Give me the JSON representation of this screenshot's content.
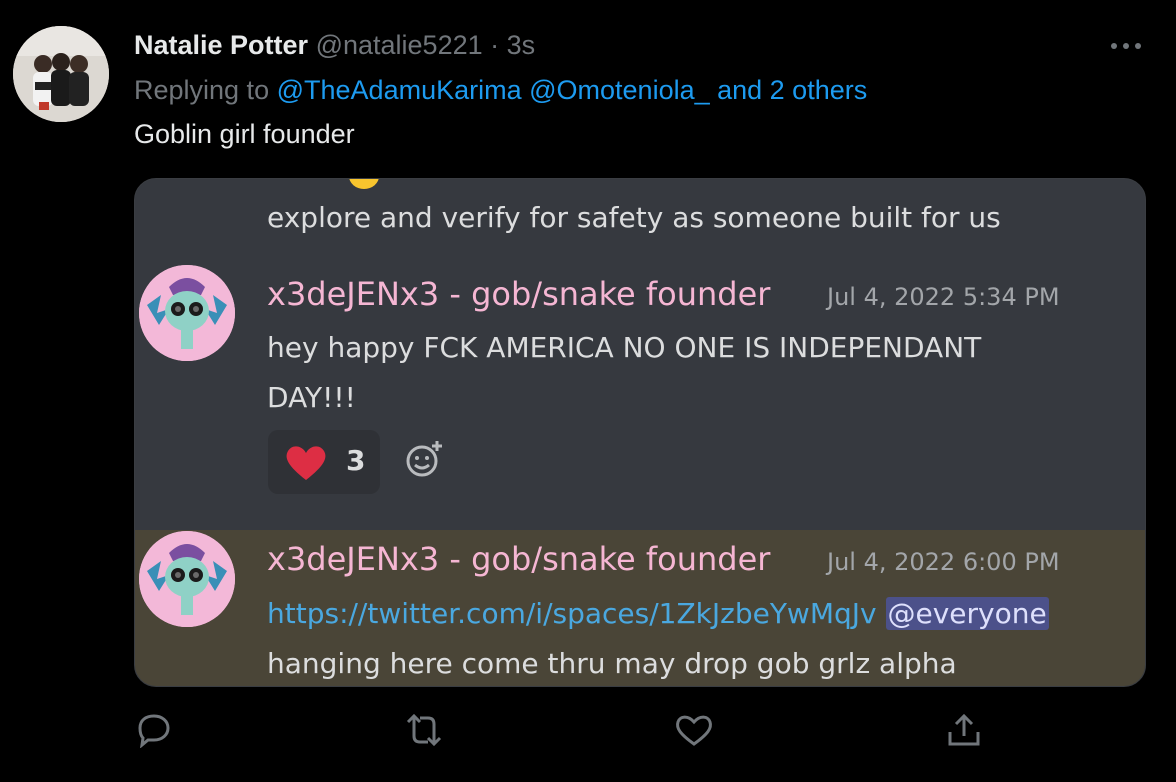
{
  "tweet": {
    "author_name": "Natalie Potter",
    "handle": "@natalie5221",
    "separator": "·",
    "time": "3s",
    "replying_prefix": "Replying to",
    "replying_users": "@TheAdamuKarima @Omoteniola_ and 2 others",
    "text": "Goblin girl founder"
  },
  "discord": {
    "partial_message": "explore and verify for safety as someone built for us",
    "messages": [
      {
        "author": "x3deJENx3 - gob/snake founder",
        "timestamp": "Jul 4, 2022 5:34 PM",
        "line1": "hey happy FCK AMERICA NO ONE IS INDEPENDANT",
        "line2": "DAY!!!",
        "reaction_emoji": "heart",
        "reaction_count": "3"
      },
      {
        "author": "x3deJENx3 - gob/snake founder",
        "timestamp": "Jul 4, 2022 6:00 PM",
        "link": "https://twitter.com/i/spaces/1ZkJzbeYwMqJv",
        "mention": "@everyone",
        "line2": "hanging here come thru may drop gob grlz alpha"
      }
    ]
  },
  "icons": [
    "more-icon",
    "reply-icon",
    "retweet-icon",
    "like-icon",
    "share-icon",
    "heart-icon",
    "add-reaction-icon"
  ],
  "colors": {
    "background": "#000000",
    "link": "#1d9bf0",
    "discord_bg": "#36393f",
    "discord_name": "#f5b6d3",
    "highlight": "#4a4537",
    "mention_bg": "#4c518a"
  }
}
